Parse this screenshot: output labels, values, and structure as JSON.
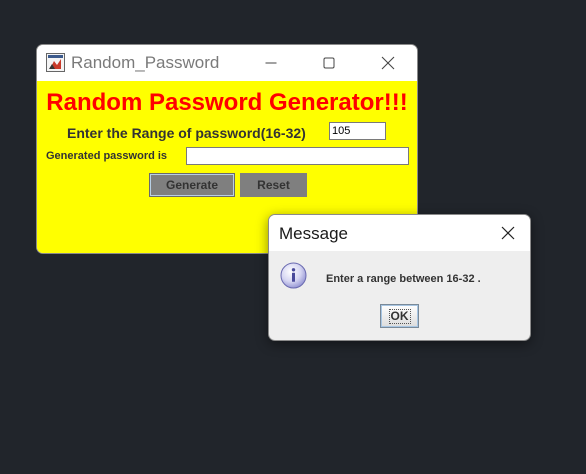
{
  "main_window": {
    "title": "Random_Password",
    "heading": "Random Password Generator!!!",
    "range_label": "Enter the Range of password(16-32)",
    "range_value": "105",
    "generated_label": "Generated password is",
    "generated_value": "",
    "generate_button": "Generate",
    "reset_button": "Reset",
    "icons": {
      "app": "java-app-icon",
      "minimize": "minimize-icon",
      "maximize": "maximize-icon",
      "close": "close-icon"
    }
  },
  "dialog": {
    "title": "Message",
    "message": "Enter a range between 16-32 .",
    "ok_button": "OK",
    "icons": {
      "info": "info-icon",
      "close": "close-icon"
    }
  },
  "colors": {
    "desktop_background": "#21252b",
    "panel_background": "#ffff00",
    "heading_text": "#ff0000",
    "button_background": "#7f7f7f",
    "dialog_background": "#eeeeee"
  }
}
